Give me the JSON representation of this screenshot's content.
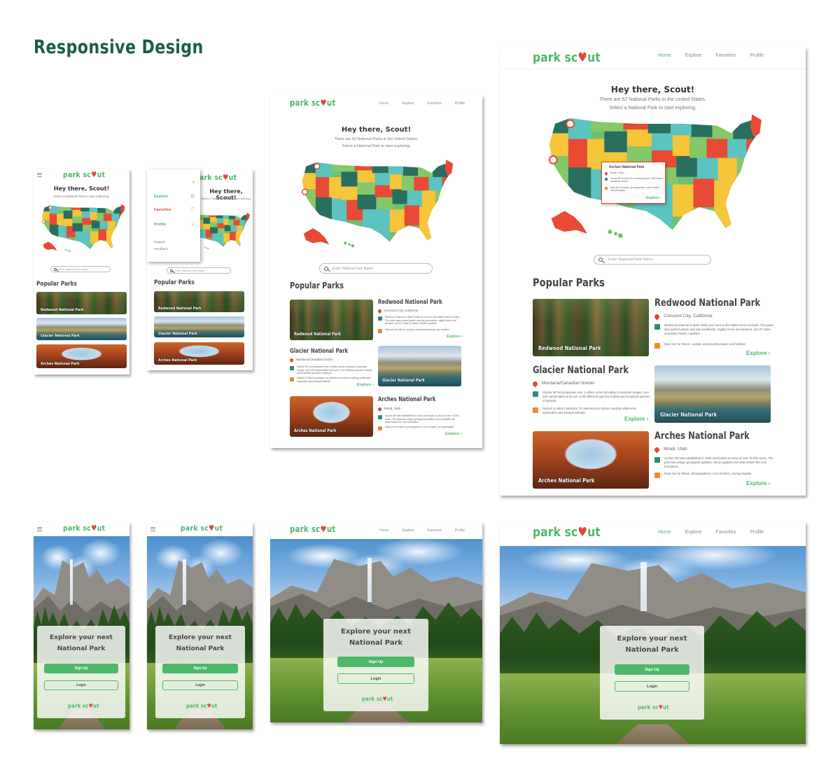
{
  "heading": "Responsive Design",
  "logo": {
    "left": "park sc",
    "heart": "♥",
    "right": "ut"
  },
  "nav": {
    "home": "Home",
    "explore": "Explore",
    "favorites": "Favorites",
    "profile": "Profile"
  },
  "greeting": "Hey there, Scout!",
  "subtitle_line1": "There are 62 National Parks in the United States.",
  "subtitle_line2": "Select a National Park to start exploring.",
  "mobile_subtitle": "Select a National Park to start exploring.",
  "search_placeholder": "Enter National Park Name",
  "popular_parks": "Popular Parks",
  "parks": [
    {
      "name": "Redwood National Park",
      "location": "Crescent City, California",
      "description": "Redwood National & State Parks are home to the tallest trees on Earth. The parks also protect prairie and oak woodlands, mighty rivers and streams, and 37 miles of pristine Pacific coastline.",
      "good_for": "Must see for hikers, cyclists, animal enthusiasts, and families"
    },
    {
      "name": "Glacier National Park",
      "location": "Montana/Canadian border",
      "description": "Glacier NP encompasses over 1 million acres including 2 mountain ranges, over 130 named lakes and over 1,000 different species of plant and hundreds species of animals.",
      "good_for": "Named 'a Hiker's paradise' for adventurous visitors seeking wilderness exploration and tranquil solitude."
    },
    {
      "name": "Arches National Park",
      "location": "Moab, Utah",
      "description": "Arches NP was established in 1929 and boasts an area of over 76,000 acres. The park has unique geological qualities, these qualities are what makes the rock formations.",
      "good_for": "Must see for hikers, photographers, rock climbers, and geologists."
    }
  ],
  "explore_link": "Explore  ›",
  "tooltip": {
    "title": "Arches National Park",
    "location": "Moab, Utah",
    "desc": "Arches NP is known for containing over 2,000 natural sandstone arches.",
    "good_for": "Must see for hikers, photographers, rock climbers, and geologists.",
    "explore": "Explore  ›"
  },
  "menu": {
    "explore": "Explore",
    "favorites": "Favorites",
    "profile": "Profile",
    "support": "Support",
    "feedback": "Feedback"
  },
  "landing": {
    "title_line1": "Explore your next",
    "title_line2": "National Park",
    "signup": "Sign Up",
    "login": "Login"
  },
  "colors": {
    "brand_green": "#4db86a",
    "heading_green": "#1d5c4a",
    "pin_red": "#e0473a",
    "orange": "#f0892f",
    "teal": "#2e8b74"
  }
}
